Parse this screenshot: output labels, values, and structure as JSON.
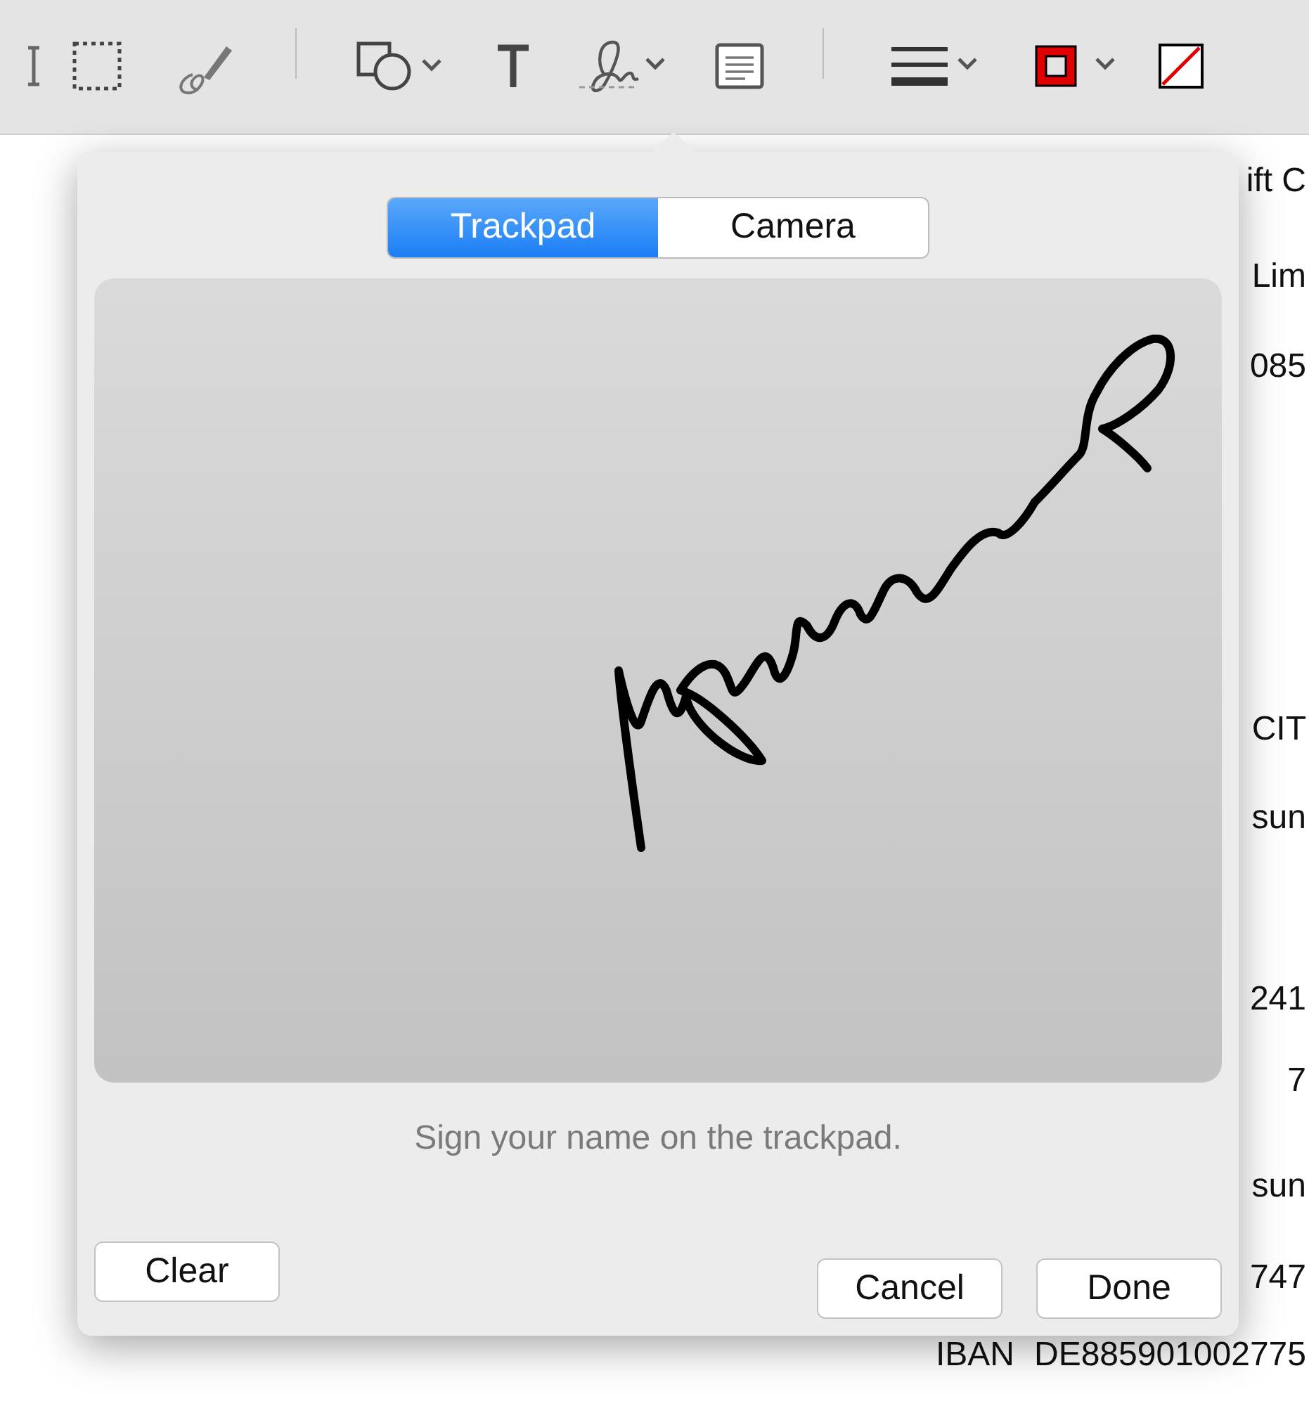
{
  "toolbar": {
    "items": [
      {
        "kind": "cursor"
      },
      {
        "kind": "select"
      },
      {
        "kind": "sketch"
      },
      {
        "kind": "divider"
      },
      {
        "kind": "shapes"
      },
      {
        "kind": "text"
      },
      {
        "kind": "sign"
      },
      {
        "kind": "note"
      },
      {
        "kind": "divider"
      },
      {
        "kind": "lines"
      },
      {
        "kind": "border"
      },
      {
        "kind": "fill"
      }
    ]
  },
  "document": {
    "lines": [
      "ift C",
      "Lim",
      "085",
      "CIT",
      "sun",
      "241",
      "7",
      "sun",
      "747"
    ],
    "bottom_row": [
      "IBAN",
      "DE885901002775"
    ]
  },
  "signature_popover": {
    "tabs": [
      {
        "label": "Trackpad",
        "selected": true
      },
      {
        "label": "Camera",
        "selected": false
      }
    ],
    "hint": "Sign your name on the trackpad.",
    "buttons": [
      {
        "label": "Clear",
        "kind": "left"
      },
      {
        "label": "Cancel",
        "kind": "right"
      },
      {
        "label": "Done",
        "kind": "right"
      }
    ]
  }
}
